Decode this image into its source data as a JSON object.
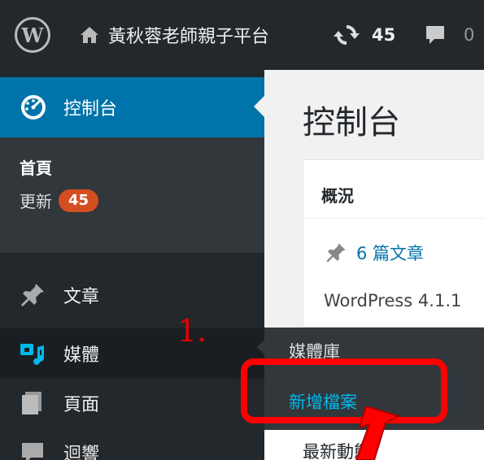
{
  "adminbar": {
    "logo_label": "W",
    "site_name": "黃秋蓉老師親子平台",
    "updates_count": "45",
    "comments_count": "0",
    "icons": [
      "wordpress-logo-icon",
      "home-icon",
      "updates-icon",
      "comments-icon"
    ]
  },
  "sidebar": {
    "dashboard_label": "控制台",
    "submenu": {
      "home_label": "首頁",
      "updates_label": "更新",
      "updates_badge": "45"
    },
    "items": [
      {
        "label": "文章",
        "icon": "pin-icon"
      },
      {
        "label": "媒體",
        "icon": "media-icon"
      },
      {
        "label": "頁面",
        "icon": "pages-icon"
      },
      {
        "label": "迴響",
        "icon": "comments-icon"
      }
    ]
  },
  "flyout": {
    "library_label": "媒體庫",
    "add_new_label": "新增檔案"
  },
  "main": {
    "page_title": "控制台",
    "postbox_title": "概況",
    "posts_count_label": "6 篇文章",
    "wp_version": "WordPress 4.1.1",
    "next_box_partial": "最新動態"
  },
  "annotation": {
    "step_label": "1.",
    "color": "#ff0000"
  },
  "colors": {
    "adminbar_bg": "#23282d",
    "active_menu": "#0073aa",
    "badge": "#d54e21",
    "link": "#0073aa",
    "flyout_link": "#00b9eb"
  }
}
